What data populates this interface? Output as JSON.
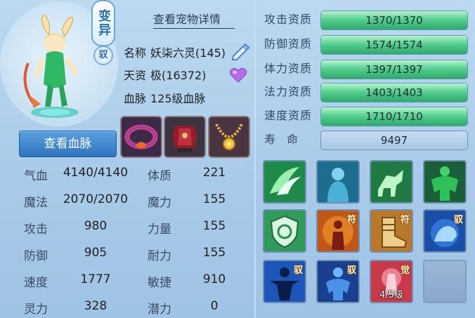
{
  "portrait": {
    "badge_variant": "变异",
    "badge_rank": "驭"
  },
  "header": {
    "detail_link": "查看宠物详情"
  },
  "info": {
    "name_label": "名称",
    "name_value": "妖柒六灵(145)",
    "aptitude_label": "天资",
    "aptitude_value": "极(16372)",
    "bloodline_label": "血脉",
    "bloodline_value": "125级血脉"
  },
  "buttons": {
    "view_bloodline": "查看血脉"
  },
  "equipment": [
    {
      "icon": "collar-equip-icon"
    },
    {
      "icon": "armor-equip-icon"
    },
    {
      "icon": "necklace-equip-icon"
    }
  ],
  "stats": [
    {
      "label": "气血",
      "value": "4140/4140"
    },
    {
      "label": "体质",
      "value": "221"
    },
    {
      "label": "魔法",
      "value": "2070/2070"
    },
    {
      "label": "魔力",
      "value": "155"
    },
    {
      "label": "攻击",
      "value": "980"
    },
    {
      "label": "力量",
      "value": "155"
    },
    {
      "label": "防御",
      "value": "905"
    },
    {
      "label": "耐力",
      "value": "155"
    },
    {
      "label": "速度",
      "value": "1777"
    },
    {
      "label": "敏捷",
      "value": "910"
    },
    {
      "label": "灵力",
      "value": "328"
    },
    {
      "label": "潜力",
      "value": "0"
    }
  ],
  "aptitudes": [
    {
      "label": "攻击资质",
      "value": "1370/1370",
      "fill": 1.0
    },
    {
      "label": "防御资质",
      "value": "1574/1574",
      "fill": 1.0
    },
    {
      "label": "体力资质",
      "value": "1397/1397",
      "fill": 1.0
    },
    {
      "label": "法力资质",
      "value": "1403/1403",
      "fill": 1.0
    },
    {
      "label": "速度资质",
      "value": "1710/1710",
      "fill": 1.0
    }
  ],
  "lifespan": {
    "label": "寿　命",
    "value": "9497"
  },
  "skills": [
    {
      "icon": "green-wings-skill-icon",
      "tag": "",
      "level": ""
    },
    {
      "icon": "blue-figure-skill-icon",
      "tag": "",
      "level": ""
    },
    {
      "icon": "green-horse-skill-icon",
      "tag": "",
      "level": ""
    },
    {
      "icon": "green-muscle-skill-icon",
      "tag": "",
      "level": ""
    },
    {
      "icon": "green-shield-skill-icon",
      "tag": "",
      "level": ""
    },
    {
      "icon": "orange-figure-skill-icon",
      "tag": "符",
      "level": ""
    },
    {
      "icon": "boot-skill-icon",
      "tag": "符",
      "level": ""
    },
    {
      "icon": "blue-beast-skill-icon",
      "tag": "驭",
      "level": ""
    },
    {
      "icon": "blue-man-skill-icon",
      "tag": "驭",
      "level": ""
    },
    {
      "icon": "blue-muscle-skill-icon",
      "tag": "驭",
      "level": ""
    },
    {
      "icon": "red-awaken-skill-icon",
      "tag": "觉",
      "level": "4/5级"
    },
    {
      "icon": "empty-slot-icon",
      "tag": "",
      "level": ""
    }
  ],
  "colors": {
    "accent_green": "#2fa86c",
    "button_blue": "#2f74c0",
    "panel_bg": "#a9cbe9"
  }
}
